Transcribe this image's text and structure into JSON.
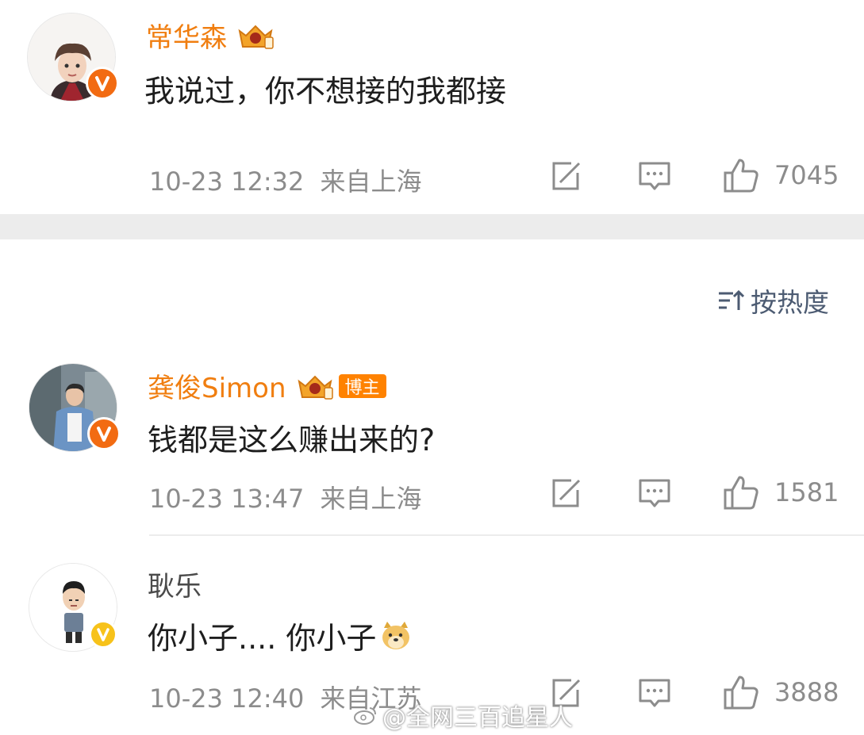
{
  "colors": {
    "name_orange": "#f07e10",
    "meta_gray": "#8c8c8c",
    "sort_blue": "#4c5b72",
    "separator": "#ececec"
  },
  "sort": {
    "label": "按热度",
    "icon": "sort-icon"
  },
  "comments": [
    {
      "name": "常华森",
      "text": "我说过，你不想接的我都接",
      "time": "10-23 12:32",
      "location": "来自上海",
      "likes": "7045",
      "badge": "crown-badge-icon",
      "verified": "orange-v-badge"
    },
    {
      "name": "龚俊Simon",
      "tag": "博主",
      "text": "钱都是这么赚出来的?",
      "time": "10-23 13:47",
      "location": "来自上海",
      "likes": "1581",
      "badge": "crown-badge-icon",
      "verified": "orange-v-badge"
    },
    {
      "name": "耿乐",
      "text": "你小子.... 你小子",
      "emoji": "doge-emoji",
      "time": "10-23 12:40",
      "location": "来自江苏",
      "likes": "3888",
      "verified": "yellow-v-badge"
    }
  ],
  "watermark": "@全网三百追星人"
}
